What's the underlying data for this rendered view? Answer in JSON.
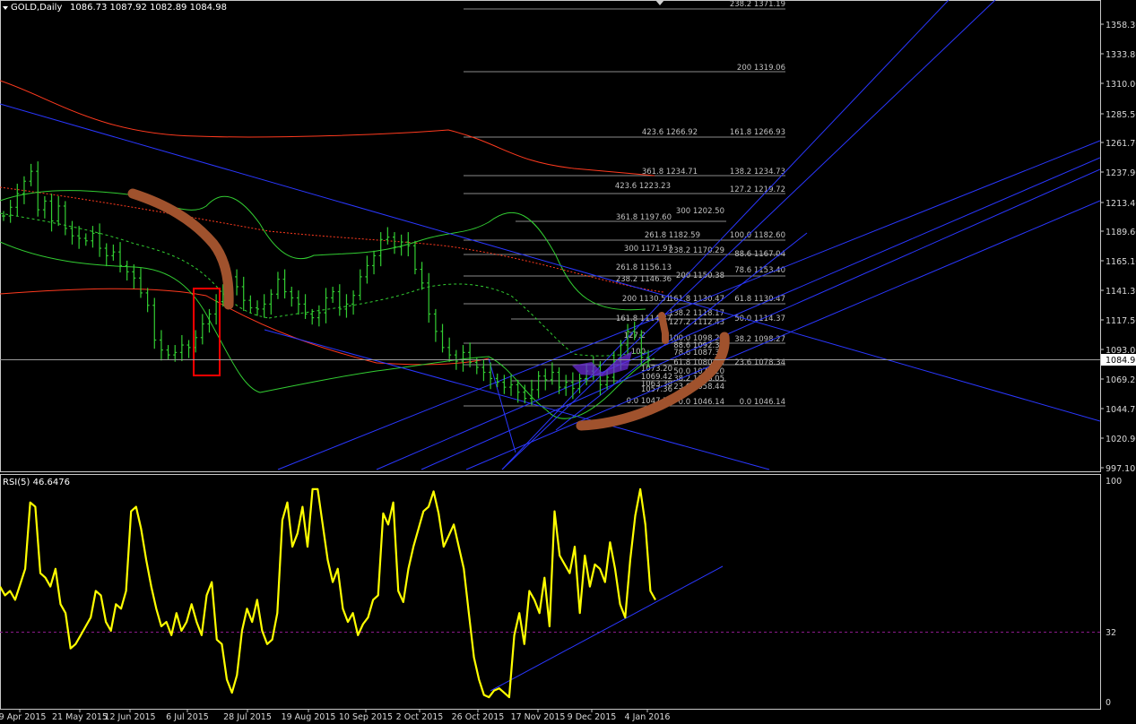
{
  "colors": {
    "background": "#000000",
    "frame": "#c8c8c8",
    "candle": "#32cd32",
    "bollinger": "#32cd32",
    "envelope": "#ff3a1e",
    "ma_dashed": "#ff3a1e",
    "trendline": "#2a37ff",
    "fib_level": "#8a8a8a",
    "fib_text": "#c0c0c0",
    "rsi": "#ffff00",
    "rsi_level": "#8b1a8b",
    "annotation_arc": "#a0522d",
    "annotation_box": "#ff0000",
    "cursor_marker": "#ffffff"
  },
  "header": {
    "symbol_label": "GOLD,Daily",
    "ohlc": "1086.73 1087.92 1082.89 1084.98",
    "menu_icon": "triangle-down-icon"
  },
  "price_axis": {
    "labels": [
      "1358.30",
      "1333.80",
      "1310.00",
      "1285.50",
      "1261.70",
      "1237.90",
      "1213.40",
      "1189.60",
      "1165.10",
      "1141.30",
      "1117.50",
      "1093.00",
      "1069.20",
      "1044.70",
      "1020.90",
      "997.10"
    ],
    "current_price": "1084.98"
  },
  "date_axis": {
    "labels": [
      "29 Apr 2015",
      "21 May 2015",
      "12 Jun 2015",
      "6 Jul 2015",
      "28 Jul 2015",
      "19 Aug 2015",
      "10 Sep 2015",
      "2 Oct 2015",
      "26 Oct 2015",
      "17 Nov 2015",
      "9 Dec 2015",
      "4 Jan 2016"
    ]
  },
  "fibonacci_labels": [
    "238.2 1371.19",
    "200 1319.06",
    "423.6 1266.92",
    "161.8 1266.93",
    "361.8 1234.71",
    "138.2 1234.73",
    "423.6 1223.23",
    "127.2 1219.72",
    "300 1202.50",
    "361.8 1197.60",
    "261.8 1182.59",
    "100.0 1182.60",
    "300 1171.97",
    "238.2 1170.29",
    "88.6 1167.04",
    "261.8 1156.13",
    "78.6 1153.40",
    "238.2 1146.36",
    "200 1150.38",
    "200 1130.51",
    "161.8 1130.47",
    "61.8 1130.47",
    "138.2 1118.17",
    "161.8 1114.87",
    "127.2 1112.43",
    "50.0 1114.37",
    "127.2",
    "100.0 1098.27",
    "38.2 1098.27",
    "88.6 1092.31",
    "100",
    "78.6 1087.31",
    "61.8 1080.95",
    "23.6 1078.34",
    "1073.20",
    "50.0 1072.20",
    "1069.42",
    "38.2 1066.05",
    "1063.38",
    "23.6 1058.44",
    "1057.36",
    "0.0 1047.58",
    "0.0 1046.14",
    "0.0 1046.14"
  ],
  "rsi_panel": {
    "label": "RSI(5) 46.6476",
    "axis_labels": [
      "100",
      "32",
      "0"
    ]
  },
  "chart_data": [
    {
      "type": "line",
      "name": "price",
      "description_units": "USD per ounce, daily closes estimated",
      "x": [
        "29 Apr 2015",
        "21 May 2015",
        "12 Jun 2015",
        "6 Jul 2015",
        "28 Jul 2015",
        "19 Aug 2015",
        "10 Sep 2015",
        "2 Oct 2015",
        "26 Oct 2015",
        "17 Nov 2015",
        "9 Dec 2015",
        "4 Jan 2016"
      ],
      "closes": [
        1200,
        1207,
        1218,
        1228,
        1236,
        1205,
        1212,
        1196,
        1208,
        1190,
        1184,
        1182,
        1180,
        1186,
        1174,
        1168,
        1171,
        1160,
        1155,
        1150,
        1138,
        1128,
        1100,
        1092,
        1088,
        1090,
        1096,
        1094,
        1102,
        1113,
        1121,
        1131,
        1137,
        1151,
        1143,
        1132,
        1126,
        1125,
        1129,
        1137,
        1149,
        1139,
        1134,
        1129,
        1121,
        1118,
        1122,
        1134,
        1139,
        1125,
        1129,
        1136,
        1151,
        1160,
        1168,
        1181,
        1183,
        1175,
        1179,
        1176,
        1157,
        1146,
        1121,
        1107,
        1094,
        1088,
        1083,
        1090,
        1082,
        1078,
        1074,
        1069,
        1066,
        1062,
        1064,
        1058,
        1053,
        1060,
        1071,
        1068,
        1074,
        1062,
        1066,
        1061,
        1069,
        1075,
        1079,
        1064,
        1070,
        1083,
        1096,
        1107,
        1104,
        1086,
        1085
      ],
      "ylim": [
        997.1,
        1371.19
      ],
      "log_scale": false,
      "grid": false
    },
    {
      "type": "line",
      "name": "RSI(5)",
      "values": [
        52,
        48,
        50,
        46,
        53,
        60,
        90,
        88,
        58,
        56,
        52,
        60,
        44,
        40,
        24,
        26,
        30,
        34,
        38,
        50,
        48,
        36,
        32,
        44,
        42,
        50,
        86,
        88,
        78,
        64,
        52,
        42,
        34,
        36,
        30,
        40,
        32,
        36,
        44,
        36,
        30,
        48,
        54,
        28,
        26,
        10,
        4,
        12,
        32,
        42,
        36,
        46,
        32,
        26,
        28,
        40,
        82,
        90,
        70,
        76,
        88,
        70,
        96,
        96,
        80,
        64,
        54,
        60,
        42,
        36,
        40,
        30,
        35,
        38,
        46,
        48,
        85,
        80,
        90,
        50,
        45,
        60,
        70,
        78,
        86,
        88,
        95,
        85,
        70,
        75,
        80,
        70,
        60,
        40,
        20,
        10,
        3,
        2,
        5,
        6,
        4,
        2,
        30,
        40,
        26,
        50,
        46,
        40,
        56,
        34,
        86,
        66,
        62,
        58,
        70,
        40,
        66,
        52,
        62,
        60,
        54,
        72,
        60,
        44,
        38,
        64,
        84,
        96,
        80,
        50,
        46
      ],
      "ylim": [
        0,
        100
      ],
      "level_line": 32,
      "grid": false
    }
  ]
}
